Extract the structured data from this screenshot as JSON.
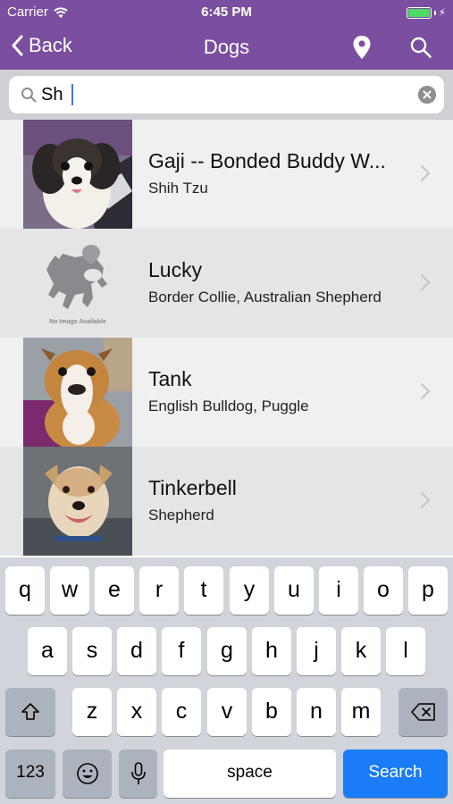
{
  "status_bar": {
    "carrier": "Carrier",
    "time": "6:45 PM",
    "battery_level": 1.0,
    "icons": [
      "wifi-icon",
      "battery-icon",
      "charging-bolt-icon"
    ]
  },
  "nav": {
    "back_label": "Back",
    "title": "Dogs",
    "icons": [
      "back-chevron-icon",
      "map-pin-icon",
      "search-icon"
    ]
  },
  "search": {
    "value": "Sh",
    "placeholder": "",
    "icons": [
      "magnifier-icon",
      "clear-icon"
    ]
  },
  "results": [
    {
      "name": "Gaji -- Bonded Buddy W...",
      "breed": "Shih Tzu",
      "image": "photo"
    },
    {
      "name": "Lucky",
      "breed": "Border Collie, Australian Shepherd",
      "image": "no-image-placeholder",
      "placeholder_text": "No Image Available"
    },
    {
      "name": "Tank",
      "breed": "English Bulldog, Puggle",
      "image": "photo"
    },
    {
      "name": "Tinkerbell",
      "breed": "Shepherd",
      "image": "photo"
    }
  ],
  "keyboard": {
    "row1": [
      "q",
      "w",
      "e",
      "r",
      "t",
      "y",
      "u",
      "i",
      "o",
      "p"
    ],
    "row2": [
      "a",
      "s",
      "d",
      "f",
      "g",
      "h",
      "j",
      "k",
      "l"
    ],
    "row3": [
      "z",
      "x",
      "c",
      "v",
      "b",
      "n",
      "m"
    ],
    "numbers_label": "123",
    "space_label": "space",
    "search_label": "Search",
    "icons": [
      "shift-icon",
      "delete-icon",
      "emoji-icon",
      "microphone-icon"
    ]
  },
  "colors": {
    "nav_purple": "#7a4f9f",
    "search_key_blue": "#1a7cf6",
    "battery_green": "#4cd964"
  }
}
